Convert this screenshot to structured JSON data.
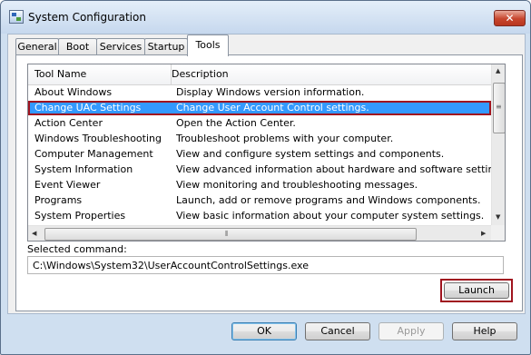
{
  "window": {
    "title": "System Configuration",
    "close_glyph": "✕"
  },
  "tabs": [
    {
      "label": "General"
    },
    {
      "label": "Boot"
    },
    {
      "label": "Services"
    },
    {
      "label": "Startup"
    },
    {
      "label": "Tools"
    }
  ],
  "tools": {
    "columns": {
      "name": "Tool Name",
      "description": "Description"
    },
    "rows": [
      {
        "name": "About Windows",
        "description": "Display Windows version information."
      },
      {
        "name": "Change UAC Settings",
        "description": "Change User Account Control settings."
      },
      {
        "name": "Action Center",
        "description": "Open the Action Center."
      },
      {
        "name": "Windows Troubleshooting",
        "description": "Troubleshoot problems with your computer."
      },
      {
        "name": "Computer Management",
        "description": "View and configure system settings and components."
      },
      {
        "name": "System Information",
        "description": "View advanced information about hardware and software settings."
      },
      {
        "name": "Event Viewer",
        "description": "View monitoring and troubleshooting messages."
      },
      {
        "name": "Programs",
        "description": "Launch, add or remove programs and Windows components."
      },
      {
        "name": "System Properties",
        "description": "View basic information about your computer system settings."
      }
    ],
    "selected_index": 1,
    "selected_command_label": "Selected command:",
    "selected_command": "C:\\Windows\\System32\\UserAccountControlSettings.exe",
    "launch_label": "Launch"
  },
  "buttons": {
    "ok": "OK",
    "cancel": "Cancel",
    "apply": "Apply",
    "help": "Help"
  },
  "icons": {
    "app": "system-configuration-icon",
    "scroll_up": "▲",
    "scroll_down": "▼",
    "scroll_left": "◀",
    "scroll_right": "▶",
    "grip_v": "≡",
    "grip_h": "⦀"
  },
  "colors": {
    "selection": "#3399ff",
    "highlight_box": "#a0141f",
    "close_button": "#c7452d"
  }
}
